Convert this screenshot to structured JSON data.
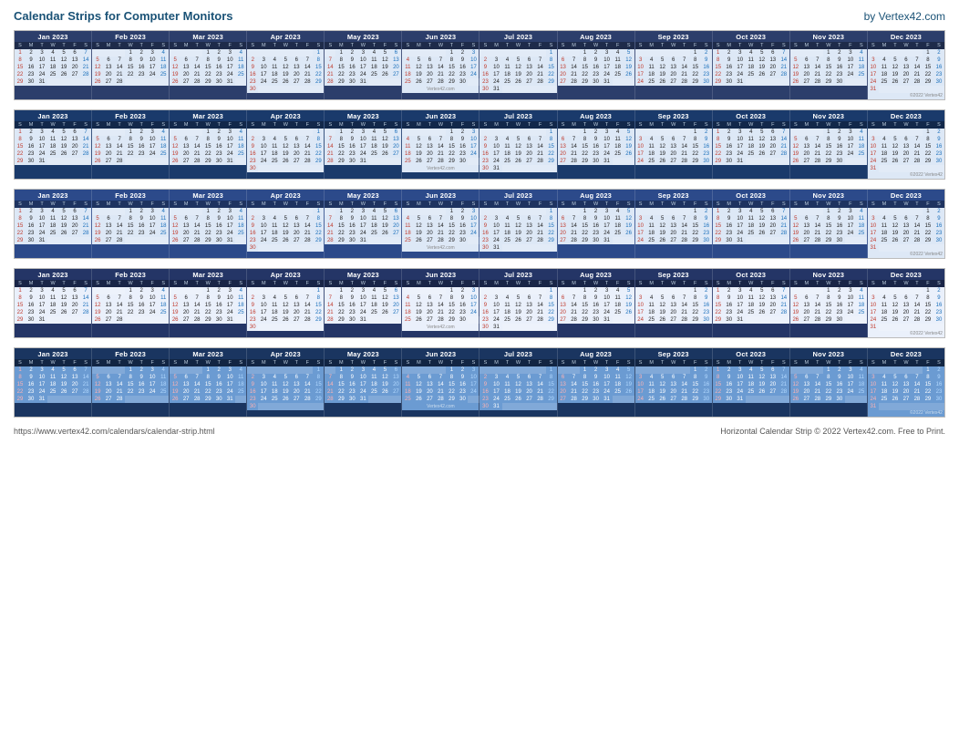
{
  "header": {
    "title": "Calendar Strips for Computer Monitors",
    "credit": "by Vertex42.com"
  },
  "footer": {
    "url": "https://www.vertex42.com/calendars/calendar-strip.html",
    "copyright": "Horizontal Calendar Strip © 2022 Vertex42.com. Free to Print."
  },
  "year": "2023",
  "months": [
    {
      "name": "Jan 2023",
      "short": "Jan",
      "startDay": 0,
      "days": 31
    },
    {
      "name": "Feb 2023",
      "short": "Feb",
      "startDay": 3,
      "days": 28
    },
    {
      "name": "Mar 2023",
      "short": "Mar",
      "startDay": 3,
      "days": 31
    },
    {
      "name": "Apr 2023",
      "short": "Apr",
      "startDay": 6,
      "days": 30
    },
    {
      "name": "May 2023",
      "short": "May",
      "startDay": 1,
      "days": 31
    },
    {
      "name": "Jun 2023",
      "short": "Jun",
      "startDay": 4,
      "days": 30
    },
    {
      "name": "Jul 2023",
      "short": "Jul",
      "startDay": 6,
      "days": 31
    },
    {
      "name": "Aug 2023",
      "short": "Aug",
      "startDay": 2,
      "days": 31
    },
    {
      "name": "Sep 2023",
      "short": "Sep",
      "startDay": 5,
      "days": 30
    },
    {
      "name": "Oct 2023",
      "short": "Oct",
      "startDay": 0,
      "days": 31
    },
    {
      "name": "Nov 2023",
      "short": "Nov",
      "startDay": 3,
      "days": 30
    },
    {
      "name": "Dec 2023",
      "short": "Dec",
      "startDay": 5,
      "days": 31
    }
  ],
  "strips": [
    {
      "id": "strip1",
      "style": "v1",
      "bg": "bg-light"
    },
    {
      "id": "strip2",
      "style": "v2",
      "bg": "bg-light"
    },
    {
      "id": "strip3",
      "style": "v3",
      "bg": "bg-light"
    },
    {
      "id": "strip4",
      "style": "v4",
      "bg": "bg-lighter"
    },
    {
      "id": "strip5",
      "style": "v5",
      "bg": "bg-blue"
    }
  ],
  "watermark": "Vertex42.com",
  "copyright_text": "©2022 Vertex42"
}
